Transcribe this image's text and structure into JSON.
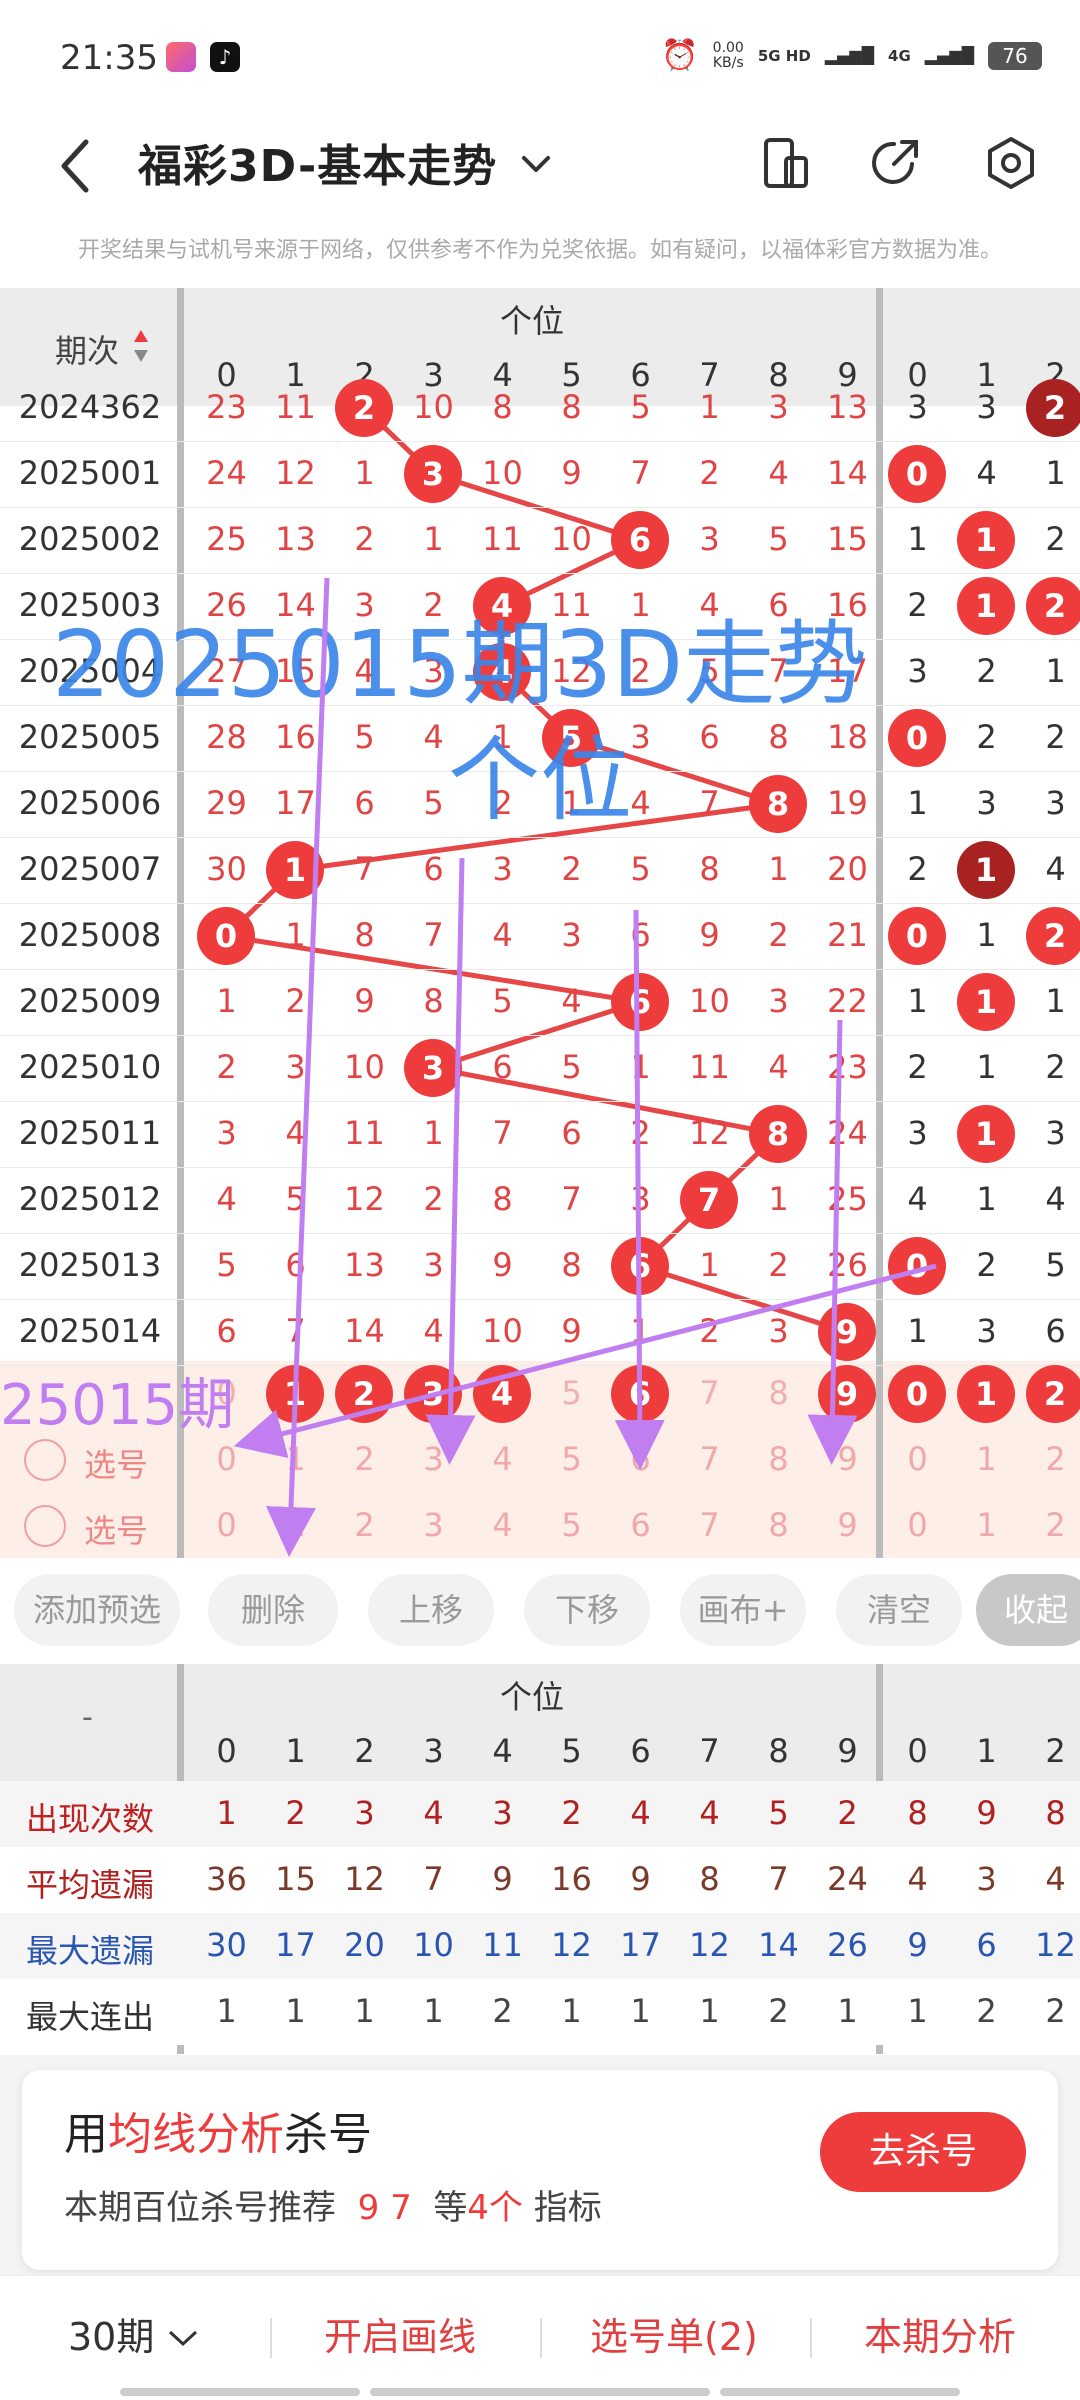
{
  "status": {
    "time": "21:35",
    "speed": "0.00",
    "speed_unit": "KB/s",
    "net1": "5G HD",
    "net2": "4G",
    "battery": "76"
  },
  "header": {
    "title": "福彩3D-基本走势",
    "disclaimer": "开奖结果与试机号来源于网络，仅供参考不作为兑奖依据。如有疑问，以福体彩官方数据为准。"
  },
  "table": {
    "issue_header": "期次",
    "group1": "个位",
    "digits": [
      "0",
      "1",
      "2",
      "3",
      "4",
      "5",
      "6",
      "7",
      "8",
      "9"
    ],
    "digits2": [
      "0",
      "1",
      "2"
    ],
    "rows": [
      {
        "issue": "2024362",
        "cells": [
          "23",
          "11",
          "2",
          "10",
          "8",
          "8",
          "5",
          "1",
          "3",
          "13"
        ],
        "hits": [
          2
        ],
        "extra": [
          "3",
          "3",
          "2"
        ],
        "extra_hits": [
          2
        ],
        "extra_dark": [
          2
        ]
      },
      {
        "issue": "2025001",
        "cells": [
          "24",
          "12",
          "1",
          "3",
          "10",
          "9",
          "7",
          "2",
          "4",
          "14"
        ],
        "hits": [
          3
        ],
        "extra": [
          "0",
          "4",
          "1"
        ],
        "extra_hits": [
          0
        ],
        "extra_dark": []
      },
      {
        "issue": "2025002",
        "cells": [
          "25",
          "13",
          "2",
          "1",
          "11",
          "10",
          "6",
          "3",
          "5",
          "15"
        ],
        "hits": [
          6
        ],
        "extra": [
          "1",
          "1",
          "2"
        ],
        "extra_hits": [
          1
        ],
        "extra_dark": []
      },
      {
        "issue": "2025003",
        "cells": [
          "26",
          "14",
          "3",
          "2",
          "4",
          "11",
          "1",
          "4",
          "6",
          "16"
        ],
        "hits": [
          4
        ],
        "extra": [
          "2",
          "1",
          "2"
        ],
        "extra_hits": [
          1,
          2
        ],
        "extra_dark": []
      },
      {
        "issue": "2025004",
        "cells": [
          "27",
          "15",
          "4",
          "3",
          "4",
          "12",
          "2",
          "5",
          "7",
          "17"
        ],
        "hits": [
          4
        ],
        "extra": [
          "3",
          "2",
          "1"
        ],
        "extra_hits": [],
        "extra_dark": []
      },
      {
        "issue": "2025005",
        "cells": [
          "28",
          "16",
          "5",
          "4",
          "1",
          "5",
          "3",
          "6",
          "8",
          "18"
        ],
        "hits": [
          5
        ],
        "extra": [
          "0",
          "2",
          "2"
        ],
        "extra_hits": [
          0
        ],
        "extra_dark": []
      },
      {
        "issue": "2025006",
        "cells": [
          "29",
          "17",
          "6",
          "5",
          "2",
          "1",
          "4",
          "7",
          "8",
          "19"
        ],
        "hits": [
          8
        ],
        "extra": [
          "1",
          "3",
          "3"
        ],
        "extra_hits": [],
        "extra_dark": []
      },
      {
        "issue": "2025007",
        "cells": [
          "30",
          "1",
          "7",
          "6",
          "3",
          "2",
          "5",
          "8",
          "1",
          "20"
        ],
        "hits": [
          1
        ],
        "extra": [
          "2",
          "1",
          "4"
        ],
        "extra_hits": [
          1
        ],
        "extra_dark": [
          1
        ]
      },
      {
        "issue": "2025008",
        "cells": [
          "0",
          "1",
          "8",
          "7",
          "4",
          "3",
          "6",
          "9",
          "2",
          "21"
        ],
        "hits": [
          0
        ],
        "extra": [
          "0",
          "1",
          "2"
        ],
        "extra_hits": [
          0,
          2
        ],
        "extra_dark": []
      },
      {
        "issue": "2025009",
        "cells": [
          "1",
          "2",
          "9",
          "8",
          "5",
          "4",
          "6",
          "10",
          "3",
          "22"
        ],
        "hits": [
          6
        ],
        "extra": [
          "1",
          "1",
          "1"
        ],
        "extra_hits": [
          1
        ],
        "extra_dark": []
      },
      {
        "issue": "2025010",
        "cells": [
          "2",
          "3",
          "10",
          "3",
          "6",
          "5",
          "1",
          "11",
          "4",
          "23"
        ],
        "hits": [
          3
        ],
        "extra": [
          "2",
          "1",
          "2"
        ],
        "extra_hits": [],
        "extra_dark": []
      },
      {
        "issue": "2025011",
        "cells": [
          "3",
          "4",
          "11",
          "1",
          "7",
          "6",
          "2",
          "12",
          "8",
          "24"
        ],
        "hits": [
          8
        ],
        "extra": [
          "3",
          "1",
          "3"
        ],
        "extra_hits": [
          1
        ],
        "extra_dark": []
      },
      {
        "issue": "2025012",
        "cells": [
          "4",
          "5",
          "12",
          "2",
          "8",
          "7",
          "3",
          "7",
          "1",
          "25"
        ],
        "hits": [
          7
        ],
        "extra": [
          "4",
          "1",
          "4"
        ],
        "extra_hits": [],
        "extra_dark": []
      },
      {
        "issue": "2025013",
        "cells": [
          "5",
          "6",
          "13",
          "3",
          "9",
          "8",
          "6",
          "1",
          "2",
          "26"
        ],
        "hits": [
          6
        ],
        "extra": [
          "0",
          "2",
          "5"
        ],
        "extra_hits": [
          0
        ],
        "extra_dark": []
      },
      {
        "issue": "2025014",
        "cells": [
          "6",
          "7",
          "14",
          "4",
          "10",
          "9",
          "1",
          "2",
          "3",
          "9"
        ],
        "hits": [
          9
        ],
        "extra": [
          "1",
          "3",
          "6"
        ],
        "extra_hits": [],
        "extra_dark": []
      }
    ],
    "sum_row": {
      "cells": [
        "0",
        "1",
        "2",
        "3",
        "4",
        "5",
        "6",
        "7",
        "8",
        "9"
      ],
      "hits": [
        1,
        2,
        3,
        4,
        6,
        9
      ],
      "extra": [
        "0",
        "1",
        "2"
      ],
      "extra_hits": [
        0,
        1,
        2
      ]
    },
    "pick_label": "选号",
    "pick_cells": [
      "0",
      "1",
      "2",
      "3",
      "4",
      "5",
      "6",
      "7",
      "8",
      "9"
    ],
    "pick_extra": [
      "0",
      "1",
      "2"
    ]
  },
  "actions": [
    "添加预选",
    "删除",
    "上移",
    "下移",
    "画布+",
    "清空",
    "收起"
  ],
  "stats": {
    "corner": "-",
    "group1": "个位",
    "rows": [
      {
        "label": "出现次数",
        "cells": [
          "1",
          "2",
          "3",
          "4",
          "3",
          "2",
          "4",
          "4",
          "5",
          "2"
        ],
        "extra": [
          "8",
          "9",
          "8"
        ],
        "color": "#b02020",
        "label_color": "#c02020"
      },
      {
        "label": "平均遗漏",
        "cells": [
          "36",
          "15",
          "12",
          "7",
          "9",
          "16",
          "9",
          "8",
          "7",
          "24"
        ],
        "extra": [
          "4",
          "3",
          "4"
        ],
        "color": "#7a3a2a",
        "label_color": "#b02020"
      },
      {
        "label": "最大遗漏",
        "cells": [
          "30",
          "17",
          "20",
          "10",
          "11",
          "12",
          "17",
          "12",
          "14",
          "26"
        ],
        "extra": [
          "9",
          "6",
          "12"
        ],
        "color": "#2a55b0",
        "label_color": "#2a55b0"
      },
      {
        "label": "最大连出",
        "cells": [
          "1",
          "1",
          "1",
          "1",
          "2",
          "1",
          "1",
          "1",
          "2",
          "1"
        ],
        "extra": [
          "1",
          "2",
          "2"
        ],
        "color": "#444",
        "label_color": "#333"
      }
    ]
  },
  "card": {
    "title_pre": "用",
    "title_hl": "均线分析",
    "title_post": "杀号",
    "sub_pre": "本期百位杀号推荐",
    "sub_nums": "9 7",
    "sub_mid": "等",
    "sub_count": "4个",
    "sub_post": "指标",
    "button": "去杀号"
  },
  "bottom": {
    "period": "30期",
    "draw_line": "开启画线",
    "pick_list": "选号单(2)",
    "analysis": "本期分析"
  },
  "overlay": {
    "title1": "2025015期3D走势",
    "title2": "个位",
    "issue_label": "25015期"
  },
  "colors": {
    "accent": "#ee3c3c",
    "overlay_blue": "#3b86e8",
    "overlay_purple": "#c07ef0"
  }
}
